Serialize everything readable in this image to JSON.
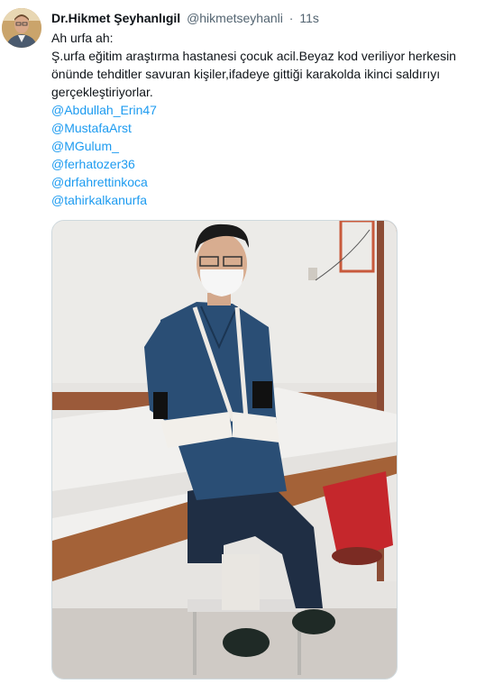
{
  "tweet": {
    "author": {
      "display_name": "Dr.Hikmet Şeyhanlıgil",
      "handle": "@hikmetseyhanli",
      "separator": "·",
      "time": "11s"
    },
    "text_lines": [
      "Ah urfa ah:",
      "Ş.urfa eğitim araştırma hastanesi çocuk acil.Beyaz kod veriliyor herkesin",
      "önünde tehditler savuran kişiler,ifadeye gittiği karakolda ikinci saldırıyı",
      "gerçekleştiriyorlar."
    ],
    "mentions": [
      "@Abdullah_Erin47",
      "@MustafaArst",
      "@MGulum_",
      "@ferhatozer36",
      "@drfahrettinkoca",
      "@tahirkalkanurfa"
    ]
  },
  "colors": {
    "text": "#0f1419",
    "secondary": "#536471",
    "link": "#1d9bf0"
  }
}
